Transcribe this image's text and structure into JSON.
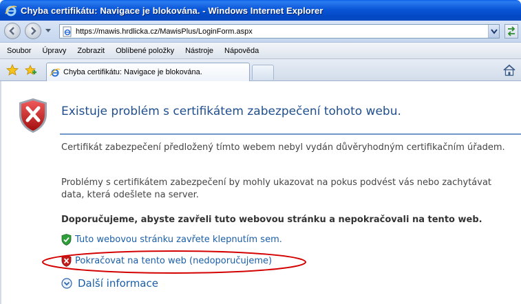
{
  "window": {
    "title": "Chyba certifikátu: Navigace je blokována. - Windows Internet Explorer"
  },
  "address": {
    "url": "https://mawis.hrdlicka.cz/MawisPlus/LoginForm.aspx"
  },
  "menu": {
    "items": [
      {
        "label": "Soubor"
      },
      {
        "label": "Úpravy"
      },
      {
        "label": "Zobrazit"
      },
      {
        "label": "Oblíbené položky"
      },
      {
        "label": "Nástroje"
      },
      {
        "label": "Nápověda"
      }
    ]
  },
  "tabs": {
    "active_label": "Chyba certifikátu: Navigace je blokována."
  },
  "page": {
    "headline": "Existuje problém s certifikátem zabezpečení tohoto webu.",
    "paragraph1": "Certifikát zabezpečení předložený tímto webem nebyl vydán důvěryhodným certifikačním úřadem.",
    "paragraph2": "Problémy s certifikátem zabezpečení by mohly ukazovat na pokus podvést vás nebo zachytávat data, která odešlete na server.",
    "recommendation": "Doporučujeme, abyste zavřeli tuto webovou stránku a nepokračovali na tento web.",
    "close_link": "Tuto webovou stránku zavřete klepnutím sem.",
    "continue_link": "Pokračovat na tento web (nedoporučujeme)",
    "more_info": "Další informace"
  },
  "colors": {
    "title_bar": "#0a56d8",
    "headline_text": "#1f4e8f",
    "link_text": "#1a5ea8",
    "highlight_oval": "#d40000",
    "error_shield": "#c61b1b",
    "ok_shield": "#2e9d3a"
  }
}
